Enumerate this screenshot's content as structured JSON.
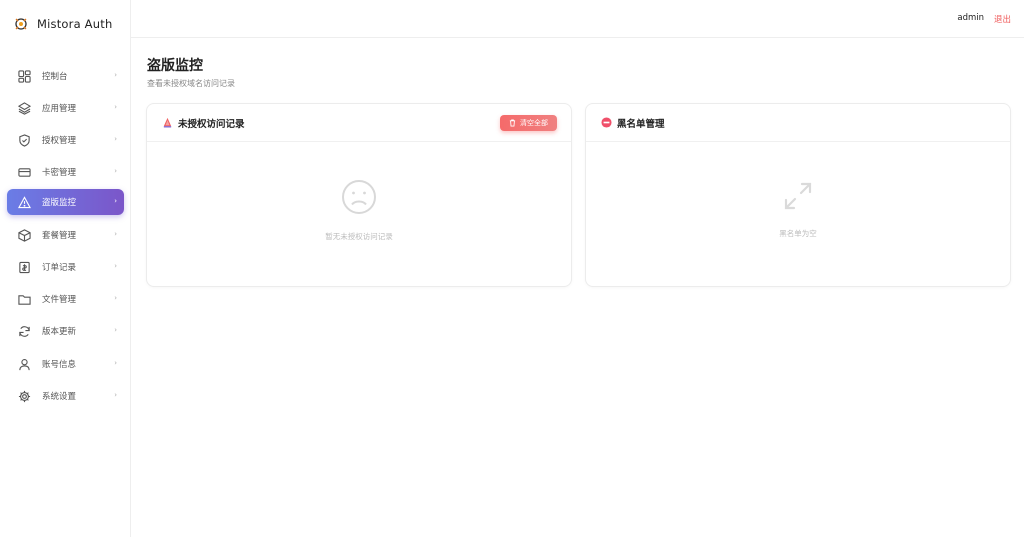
{
  "app": {
    "name": "Mistora Auth"
  },
  "header": {
    "user": "admin",
    "logout_label": "退出"
  },
  "sidebar": {
    "items": [
      {
        "label": "控制台",
        "icon": "dashboard-icon",
        "chevron": "›"
      },
      {
        "label": "应用管理",
        "icon": "layers-icon",
        "chevron": "›"
      },
      {
        "label": "授权管理",
        "icon": "shield-icon",
        "chevron": "›"
      },
      {
        "label": "卡密管理",
        "icon": "card-icon",
        "chevron": "›"
      },
      {
        "label": "盗版监控",
        "icon": "warning-icon",
        "chevron": "›",
        "active": true
      },
      {
        "label": "套餐管理",
        "icon": "package-icon",
        "chevron": "›"
      },
      {
        "label": "订单记录",
        "icon": "receipt-icon",
        "chevron": "›"
      },
      {
        "label": "文件管理",
        "icon": "folder-icon",
        "chevron": "›"
      },
      {
        "label": "版本更新",
        "icon": "refresh-icon",
        "chevron": "›"
      },
      {
        "label": "账号信息",
        "icon": "user-icon",
        "chevron": "›"
      },
      {
        "label": "系统设置",
        "icon": "gear-icon",
        "chevron": "›"
      }
    ]
  },
  "page": {
    "title": "盗版监控",
    "subtitle": "查看未授权域名访问记录"
  },
  "unauthorized_card": {
    "title": "未授权访问记录",
    "clear_label": "清空全部",
    "empty_text": "暂无未授权访问记录"
  },
  "blacklist_card": {
    "title": "黑名单管理",
    "empty_text": "黑名单为空"
  },
  "colors": {
    "accent_start": "#6a7de6",
    "accent_end": "#7b56c9",
    "danger": "#f05a5a"
  }
}
